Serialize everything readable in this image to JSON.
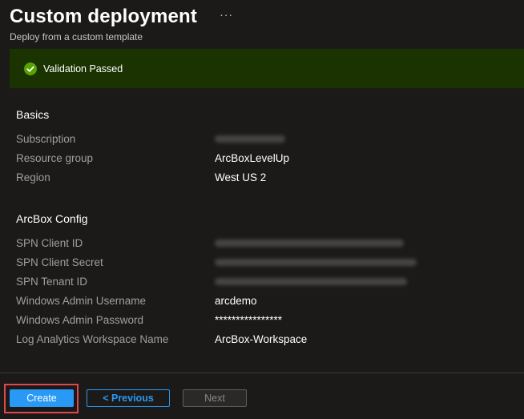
{
  "header": {
    "title": "Custom deployment",
    "more_label": "···",
    "subtitle": "Deploy from a custom template"
  },
  "banner": {
    "text": "Validation Passed",
    "icon": "check-circle-icon",
    "color": "#1a3300"
  },
  "basics": {
    "title": "Basics",
    "rows": [
      {
        "label": "Subscription",
        "value": "",
        "redacted": true
      },
      {
        "label": "Resource group",
        "value": "ArcBoxLevelUp",
        "redacted": false
      },
      {
        "label": "Region",
        "value": "West US 2",
        "redacted": false
      }
    ]
  },
  "arcbox": {
    "title": "ArcBox Config",
    "rows": [
      {
        "label": "SPN Client ID",
        "value": "",
        "redacted": true
      },
      {
        "label": "SPN Client Secret",
        "value": "",
        "redacted": true
      },
      {
        "label": "SPN Tenant ID",
        "value": "",
        "redacted": true
      },
      {
        "label": "Windows Admin Username",
        "value": "arcdemo",
        "redacted": false
      },
      {
        "label": "Windows Admin Password",
        "value": "****************",
        "redacted": false
      },
      {
        "label": "Log Analytics Workspace Name",
        "value": "ArcBox-Workspace",
        "redacted": false
      }
    ]
  },
  "footer": {
    "create_label": "Create",
    "previous_label": "< Previous",
    "next_label": "Next"
  },
  "colors": {
    "accent": "#2899f5",
    "success": "#57a300",
    "highlight": "#e0484e"
  }
}
